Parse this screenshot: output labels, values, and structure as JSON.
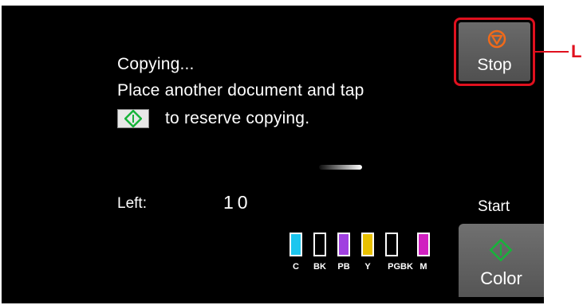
{
  "screen": {
    "status": "Copying...",
    "instruction_line1": "Place another document and tap",
    "instruction_line2": "to reserve copying.",
    "left_label": "Left:",
    "left_value": "10"
  },
  "inks": [
    {
      "label": "C",
      "color": "#1cc6ef"
    },
    {
      "label": "BK",
      "color": "#000000"
    },
    {
      "label": "PB",
      "color": "#a040e0"
    },
    {
      "label": "Y",
      "color": "#e8c000"
    },
    {
      "label": "PGBK",
      "color": "#000000"
    },
    {
      "label": "M",
      "color": "#d020c0"
    }
  ],
  "buttons": {
    "stop_label": "Stop",
    "start_caption": "Start",
    "color_label": "Color"
  },
  "callout": {
    "letter": "L"
  },
  "colors": {
    "start_icon": "#17b33a",
    "stop_icon": "#f06a1a",
    "callout": "#e0101e"
  },
  "progress_icon": "start-diamond-icon"
}
